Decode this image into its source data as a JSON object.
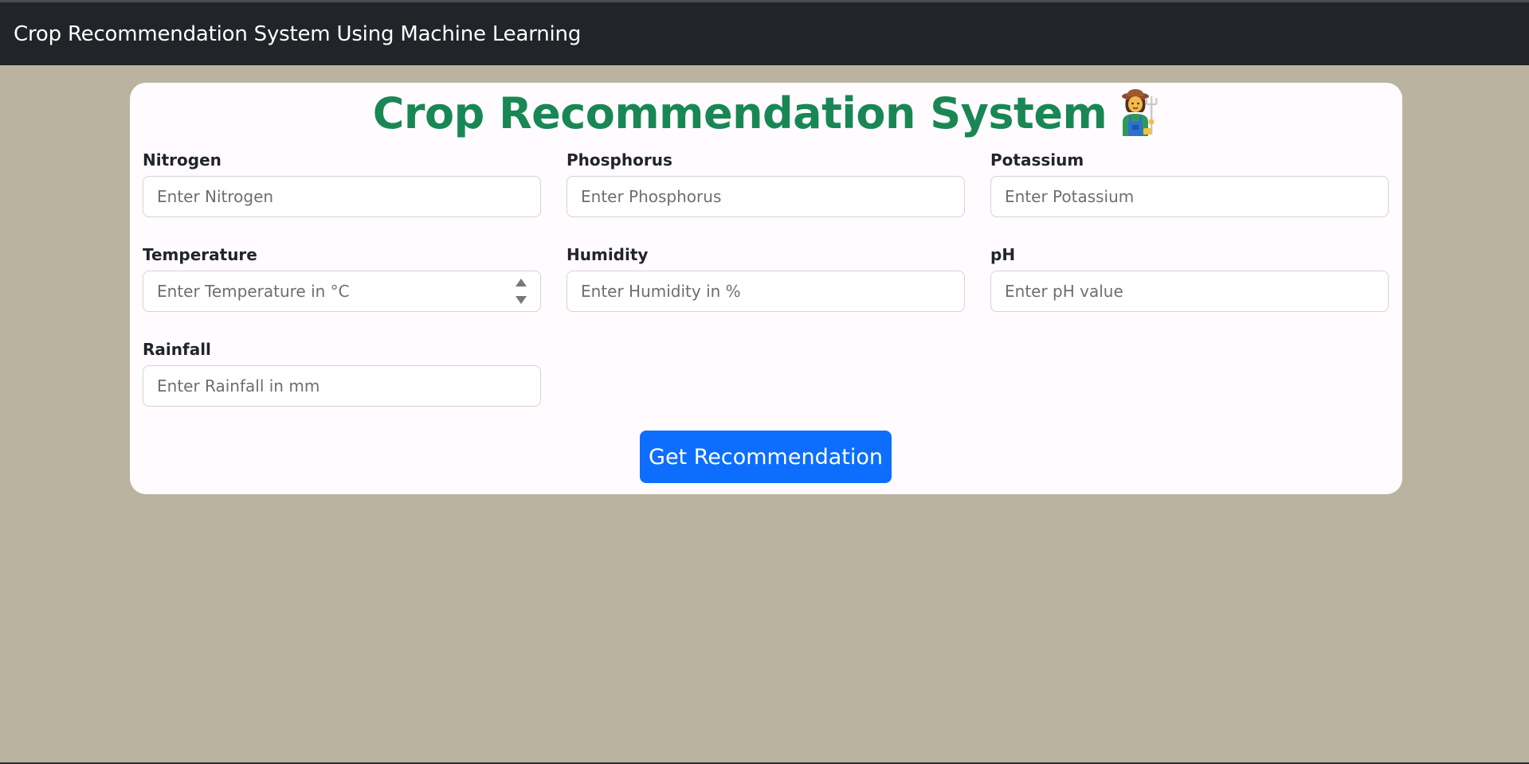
{
  "navbar": {
    "brand": "Crop Recommendation System Using Machine Learning"
  },
  "card": {
    "title": "Crop Recommendation System",
    "title_icon": "farmer-icon"
  },
  "fields": {
    "nitrogen": {
      "label": "Nitrogen",
      "placeholder": "Enter Nitrogen",
      "value": ""
    },
    "phosphorus": {
      "label": "Phosphorus",
      "placeholder": "Enter Phosphorus",
      "value": ""
    },
    "potassium": {
      "label": "Potassium",
      "placeholder": "Enter Potassium",
      "value": ""
    },
    "temperature": {
      "label": "Temperature",
      "placeholder": "Enter Temperature in °C",
      "value": ""
    },
    "humidity": {
      "label": "Humidity",
      "placeholder": "Enter Humidity in %",
      "value": ""
    },
    "ph": {
      "label": "pH",
      "placeholder": "Enter pH value",
      "value": ""
    },
    "rainfall": {
      "label": "Rainfall",
      "placeholder": "Enter Rainfall in mm",
      "value": ""
    }
  },
  "submit": {
    "label": "Get Recommendation"
  },
  "colors": {
    "background": "#bab3a0",
    "navbar": "#212529",
    "title": "#198754",
    "button": "#0d6efd"
  }
}
